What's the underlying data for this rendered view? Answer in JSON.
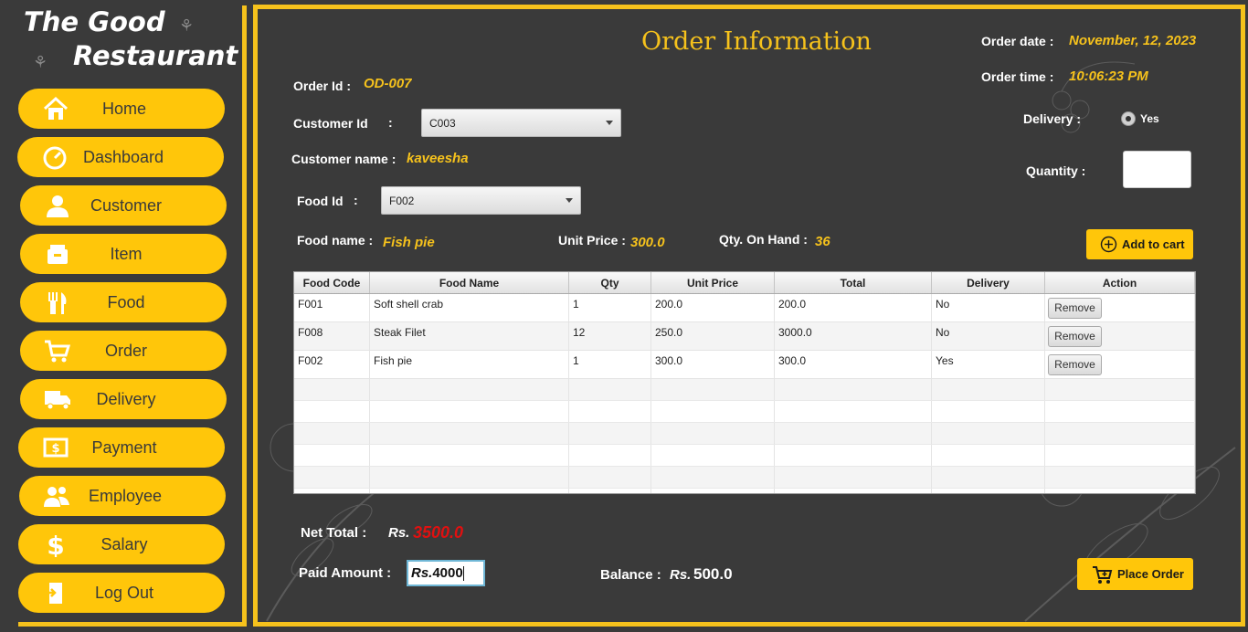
{
  "logo": {
    "line1": "The Good",
    "line2": "Restaurant"
  },
  "nav": [
    {
      "label": "Home",
      "icon": "home-icon"
    },
    {
      "label": "Dashboard",
      "icon": "dashboard-icon"
    },
    {
      "label": "Customer",
      "icon": "customer-icon"
    },
    {
      "label": "Item",
      "icon": "item-icon"
    },
    {
      "label": "Food",
      "icon": "food-icon"
    },
    {
      "label": "Order",
      "icon": "cart-icon"
    },
    {
      "label": "Delivery",
      "icon": "delivery-truck-icon"
    },
    {
      "label": "Payment",
      "icon": "payment-icon"
    },
    {
      "label": "Employee",
      "icon": "employee-icon"
    },
    {
      "label": "Salary",
      "icon": "dollar-icon"
    },
    {
      "label": "Log Out",
      "icon": "logout-icon"
    }
  ],
  "title": "Order Information",
  "order": {
    "id_label": "Order Id :",
    "id_value": "OD-007",
    "date_label": "Order date :",
    "date_value": "November,  12, 2023",
    "time_label": "Order time :",
    "time_value": "10:06:23 PM",
    "customer_id_label": "Customer Id",
    "customer_id_colon": ":",
    "customer_id_value": "C003",
    "customer_name_label": "Customer name :",
    "customer_name_value": "kaveesha",
    "delivery_label": "Delivery :",
    "delivery_option": "Yes",
    "quantity_label": "Quantity :",
    "food_id_label": "Food Id",
    "food_id_colon": ":",
    "food_id_value": "F002",
    "food_name_label": "Food name :",
    "food_name_value": "Fish pie",
    "unit_price_label": "Unit Price :",
    "unit_price_value": "300.0",
    "qty_on_hand_label": "Qty. On Hand :",
    "qty_on_hand_value": "36",
    "add_to_cart_label": "Add to cart"
  },
  "table": {
    "columns": [
      "Food Code",
      "Food Name",
      "Qty",
      "Unit Price",
      "Total",
      "Delivery",
      "Action"
    ],
    "rows": [
      {
        "code": "F001",
        "name": "Soft shell crab",
        "qty": "1",
        "unit_price": "200.0",
        "total": "200.0",
        "delivery": "No",
        "action": "Remove"
      },
      {
        "code": "F008",
        "name": "Steak Filet",
        "qty": "12",
        "unit_price": "250.0",
        "total": "3000.0",
        "delivery": "No",
        "action": "Remove"
      },
      {
        "code": "F002",
        "name": "Fish pie",
        "qty": "1",
        "unit_price": "300.0",
        "total": "300.0",
        "delivery": "Yes",
        "action": "Remove"
      }
    ]
  },
  "summary": {
    "net_total_label": "Net Total :",
    "net_total_prefix": "Rs.",
    "net_total_value": "3500.0",
    "paid_label": "Paid Amount :",
    "paid_prefix": "Rs.",
    "paid_value": "4000",
    "balance_label": "Balance :",
    "balance_prefix": "Rs.",
    "balance_value": "500.0",
    "place_order_label": "Place Order"
  },
  "colors": {
    "accent": "#ffc60a",
    "background": "#3a3a3a",
    "net_total": "#e01010"
  }
}
